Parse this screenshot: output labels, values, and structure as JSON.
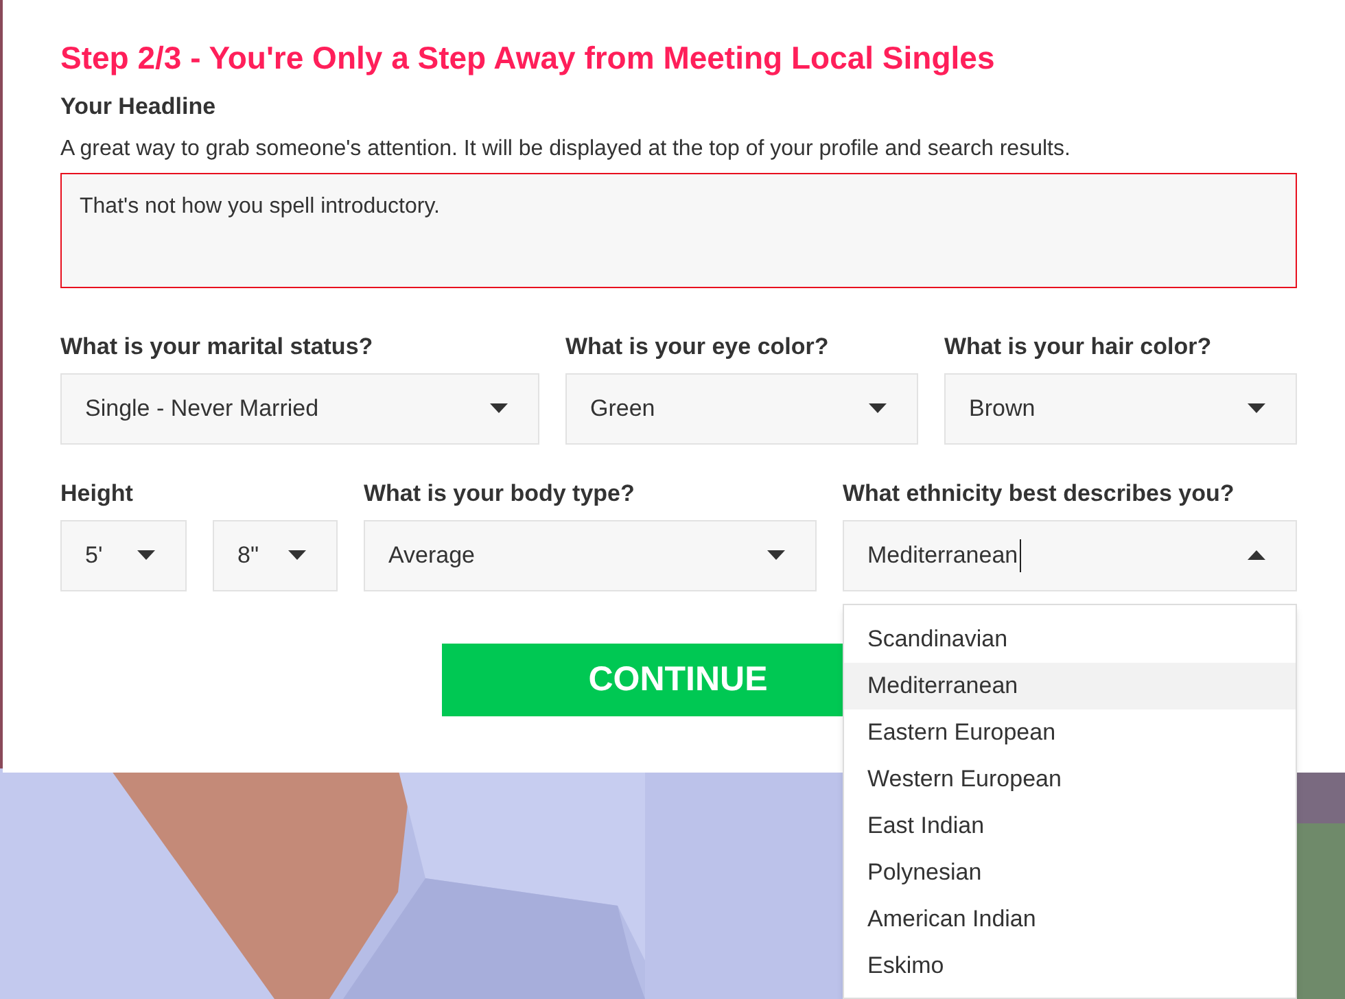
{
  "title": "Step 2/3 - You're Only a Step Away from Meeting Local Singles",
  "headline": {
    "label": "Your Headline",
    "description": "A great way to grab someone's attention. It will be displayed at the top of your profile and search results.",
    "value": "That's not how you spell introductory.",
    "invalid": true
  },
  "row_1": [
    {
      "label": "What is your marital status?",
      "value": "Single - Never Married",
      "expanded": false
    },
    {
      "label": "What is your eye color?",
      "value": "Green",
      "expanded": false
    },
    {
      "label": "What is your hair color?",
      "value": "Brown",
      "expanded": false
    }
  ],
  "height": {
    "label": "Height",
    "feet": {
      "value": "5'",
      "expanded": false
    },
    "inches": {
      "value": "8\"",
      "expanded": false
    }
  },
  "body_type": {
    "label": "What is your body type?",
    "value": "Average",
    "expanded": false
  },
  "ethnicity": {
    "label": "What ethnicity best describes you?",
    "value": "Mediterranean",
    "expanded": true,
    "options": [
      {
        "label": "Scandinavian",
        "selected": false
      },
      {
        "label": "Mediterranean",
        "selected": true
      },
      {
        "label": "Eastern European",
        "selected": false
      },
      {
        "label": "Western European",
        "selected": false
      },
      {
        "label": "East Indian",
        "selected": false
      },
      {
        "label": "Polynesian",
        "selected": false
      },
      {
        "label": "American Indian",
        "selected": false
      },
      {
        "label": "Eskimo",
        "selected": false
      }
    ]
  },
  "continue_button": "CONTINUE"
}
